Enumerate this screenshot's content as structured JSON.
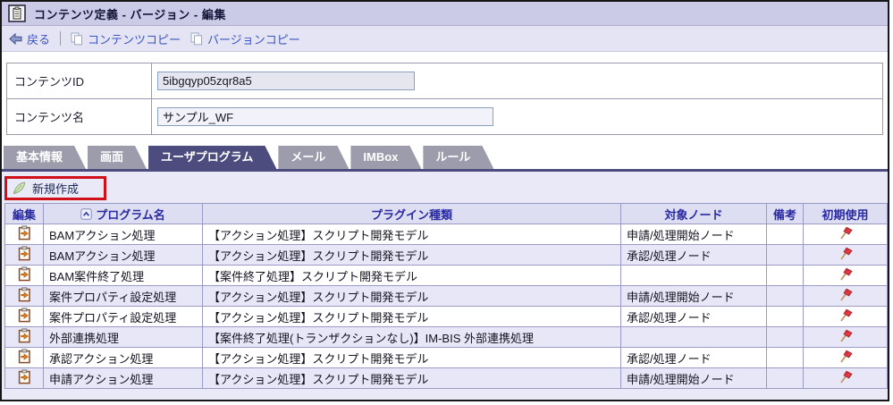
{
  "window": {
    "title": "コンテンツ定義 - バージョン - 編集"
  },
  "toolbar": {
    "back_label": "戻る",
    "content_copy_label": "コンテンツコピー",
    "version_copy_label": "バージョンコピー"
  },
  "form": {
    "fields": [
      {
        "label": "コンテンツID",
        "value": "5ibgqyp05zqr8a5",
        "readonly": true
      },
      {
        "label": "コンテンツ名",
        "value": "サンプル_WF",
        "readonly": false
      }
    ]
  },
  "tabs": [
    {
      "id": "basic",
      "label": "基本情報",
      "active": false
    },
    {
      "id": "screen",
      "label": "画面",
      "active": false
    },
    {
      "id": "userpgm",
      "label": "ユーザプログラム",
      "active": true
    },
    {
      "id": "mail",
      "label": "メール",
      "active": false
    },
    {
      "id": "imbox",
      "label": "IMBox",
      "active": false
    },
    {
      "id": "rule",
      "label": "ルール",
      "active": false
    }
  ],
  "actions": {
    "create_new_label": "新規作成",
    "create_new_highlighted": true
  },
  "table": {
    "headers": {
      "edit": "編集",
      "program_name": "プログラム名",
      "plugin_type": "プラグイン種類",
      "target_node": "対象ノード",
      "note": "備考",
      "initial_use": "初期使用"
    },
    "sort": {
      "column": "program_name",
      "direction": "ascending"
    },
    "rows": [
      {
        "program_name": "BAMアクション処理",
        "plugin_type": "【アクション処理】スクリプト開発モデル",
        "target_node": "申請/処理開始ノード",
        "note": "",
        "initial_use": true
      },
      {
        "program_name": "BAMアクション処理",
        "plugin_type": "【アクション処理】スクリプト開発モデル",
        "target_node": "承認/処理ノード",
        "note": "",
        "initial_use": true
      },
      {
        "program_name": "BAM案件終了処理",
        "plugin_type": "【案件終了処理】スクリプト開発モデル",
        "target_node": "",
        "note": "",
        "initial_use": true
      },
      {
        "program_name": "案件プロパティ設定処理",
        "plugin_type": "【アクション処理】スクリプト開発モデル",
        "target_node": "申請/処理開始ノード",
        "note": "",
        "initial_use": true
      },
      {
        "program_name": "案件プロパティ設定処理",
        "plugin_type": "【アクション処理】スクリプト開発モデル",
        "target_node": "承認/処理ノード",
        "note": "",
        "initial_use": true
      },
      {
        "program_name": "外部連携処理",
        "plugin_type": "【案件終了処理(トランザクションなし)】IM-BIS 外部連携処理",
        "target_node": "",
        "note": "",
        "initial_use": true
      },
      {
        "program_name": "承認アクション処理",
        "plugin_type": "【アクション処理】スクリプト開発モデル",
        "target_node": "承認/処理ノード",
        "note": "",
        "initial_use": true
      },
      {
        "program_name": "申請アクション処理",
        "plugin_type": "【アクション処理】スクリプト開発モデル",
        "target_node": "申請/処理開始ノード",
        "note": "",
        "initial_use": true
      }
    ]
  },
  "icons": {
    "title": "clipboard-icon",
    "back": "back-arrow-icon",
    "copy": "copy-pages-icon",
    "create_new": "quill-feather-icon",
    "sort": "sort-ascending-icon",
    "edit": "edit-clipboard-arrow-icon",
    "initial_use": "red-flag-icon"
  },
  "colors": {
    "title_bar_bg": "#cbcbe8",
    "toolbar_bg": "#e4e4f4",
    "link_blue": "#3a55be",
    "tab_active_bg": "#4c4c7e",
    "tab_inactive_bg": "#9c9cac",
    "panel_bg": "#e9e9f7",
    "table_header_bg": "#dedef2",
    "table_header_text": "#2a2aa2",
    "row_alt_bg": "#e7e7f8",
    "table_border": "#9a9ac4",
    "highlight_red": "#cf1019",
    "flag_red": "#dd3a42"
  }
}
